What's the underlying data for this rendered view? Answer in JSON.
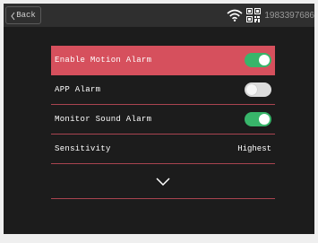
{
  "header": {
    "back_label": "Back",
    "device_id": "1983397686"
  },
  "icons": {
    "back": "chevron-left-icon",
    "wifi": "wifi-icon",
    "qr": "qr-code-icon",
    "expand": "chevron-down-icon"
  },
  "colors": {
    "highlight": "#d6505d",
    "toggle_on": "#38b56a",
    "toggle_off": "#dcdcdc",
    "divider": "#a94450",
    "background": "#1c1c1c",
    "topbar": "#2f2f2f"
  },
  "settings": {
    "items": [
      {
        "label": "Enable Motion Alarm",
        "type": "toggle",
        "state": "on",
        "selected": true
      },
      {
        "label": "APP Alarm",
        "type": "toggle",
        "state": "off",
        "selected": false
      },
      {
        "label": "Monitor Sound Alarm",
        "type": "toggle",
        "state": "on",
        "selected": false
      },
      {
        "label": "Sensitivity",
        "type": "value",
        "value": "Highest",
        "selected": false
      }
    ]
  }
}
